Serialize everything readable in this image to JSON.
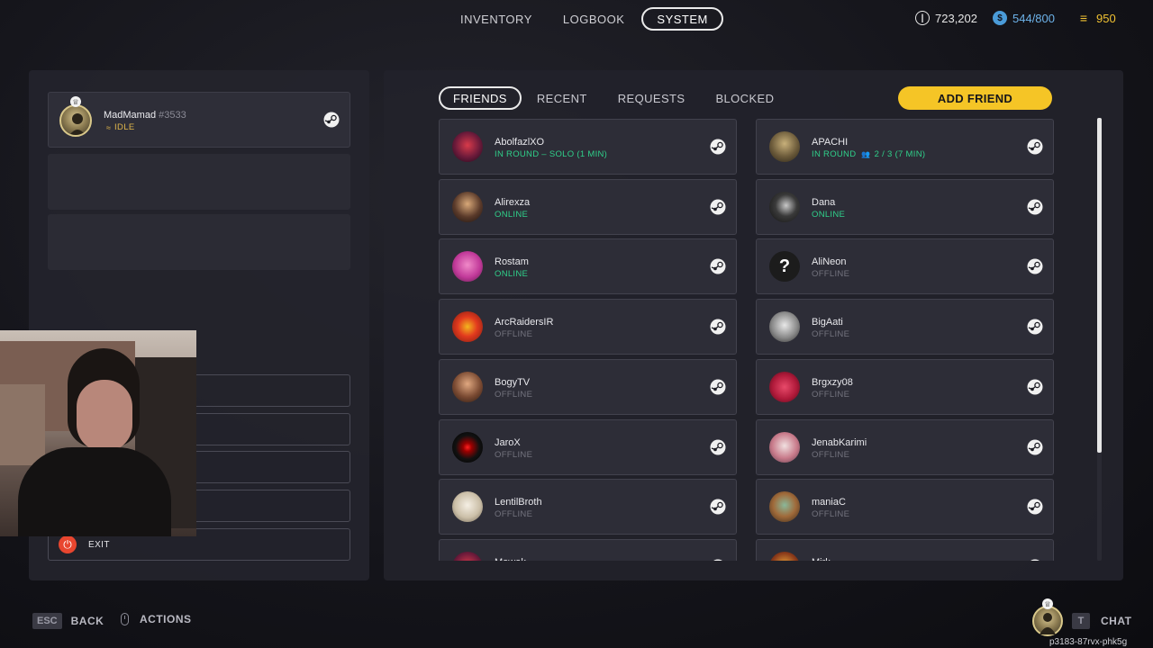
{
  "topnav": {
    "tabs": [
      {
        "label": "INVENTORY",
        "active": false
      },
      {
        "label": "LOGBOOK",
        "active": false
      },
      {
        "label": "SYSTEM",
        "active": true
      }
    ],
    "currencies": {
      "coins": "723,202",
      "cred": "544/800",
      "raider_tokens": "950"
    }
  },
  "profile": {
    "name": "MadMamad",
    "tag": "#3533",
    "status": "IDLE"
  },
  "menu": {
    "exit_label": "EXIT"
  },
  "friends": {
    "tabs": [
      {
        "label": "FRIENDS",
        "active": true
      },
      {
        "label": "RECENT",
        "active": false
      },
      {
        "label": "REQUESTS",
        "active": false
      },
      {
        "label": "BLOCKED",
        "active": false
      }
    ],
    "add_friend_label": "ADD FRIEND",
    "list": [
      {
        "name": "AbolfazlXO",
        "status": "IN ROUND – SOLO (1 MIN)",
        "state": "inround",
        "avatar": "red-mask"
      },
      {
        "name": "APACHI",
        "status": "IN ROUND",
        "party": "2 / 3 (7 MIN)",
        "state": "inround",
        "avatar": "robot"
      },
      {
        "name": "Alirexza",
        "status": "ONLINE",
        "state": "online",
        "avatar": "person-dark"
      },
      {
        "name": "Dana",
        "status": "ONLINE",
        "state": "online",
        "avatar": "bird"
      },
      {
        "name": "Rostam",
        "status": "ONLINE",
        "state": "online",
        "avatar": "pink"
      },
      {
        "name": "AliNeon",
        "status": "OFFLINE",
        "state": "offline",
        "avatar": "question"
      },
      {
        "name": "ArcRaidersIR",
        "status": "OFFLINE",
        "state": "offline",
        "avatar": "angry-bird"
      },
      {
        "name": "BigAati",
        "status": "OFFLINE",
        "state": "offline",
        "avatar": "sketch"
      },
      {
        "name": "BogyTV",
        "status": "OFFLINE",
        "state": "offline",
        "avatar": "beard-man"
      },
      {
        "name": "Brgxzy08",
        "status": "OFFLINE",
        "state": "offline",
        "avatar": "red-art"
      },
      {
        "name": "JaroX",
        "status": "OFFLINE",
        "state": "offline",
        "avatar": "red-eye"
      },
      {
        "name": "JenabKarimi",
        "status": "OFFLINE",
        "state": "offline",
        "avatar": "cartoon"
      },
      {
        "name": "LentilBroth",
        "status": "OFFLINE",
        "state": "offline",
        "avatar": "cat"
      },
      {
        "name": "maniaC",
        "status": "OFFLINE",
        "state": "offline",
        "avatar": "green-art"
      },
      {
        "name": "Mowak",
        "status": "",
        "state": "offline",
        "avatar": "red-mask"
      },
      {
        "name": "Mirk",
        "status": "",
        "state": "offline",
        "avatar": "orange"
      }
    ]
  },
  "bottom": {
    "esc_key": "ESC",
    "back_label": "BACK",
    "actions_label": "ACTIONS",
    "chat_key": "T",
    "chat_label": "CHAT",
    "session_code": "p3183-87rvx-phk5g"
  },
  "colors": {
    "accent_yellow": "#f5c526",
    "online_green": "#2fd08a",
    "offline_gray": "#73737e",
    "idle_yellow": "#e0b64a"
  }
}
